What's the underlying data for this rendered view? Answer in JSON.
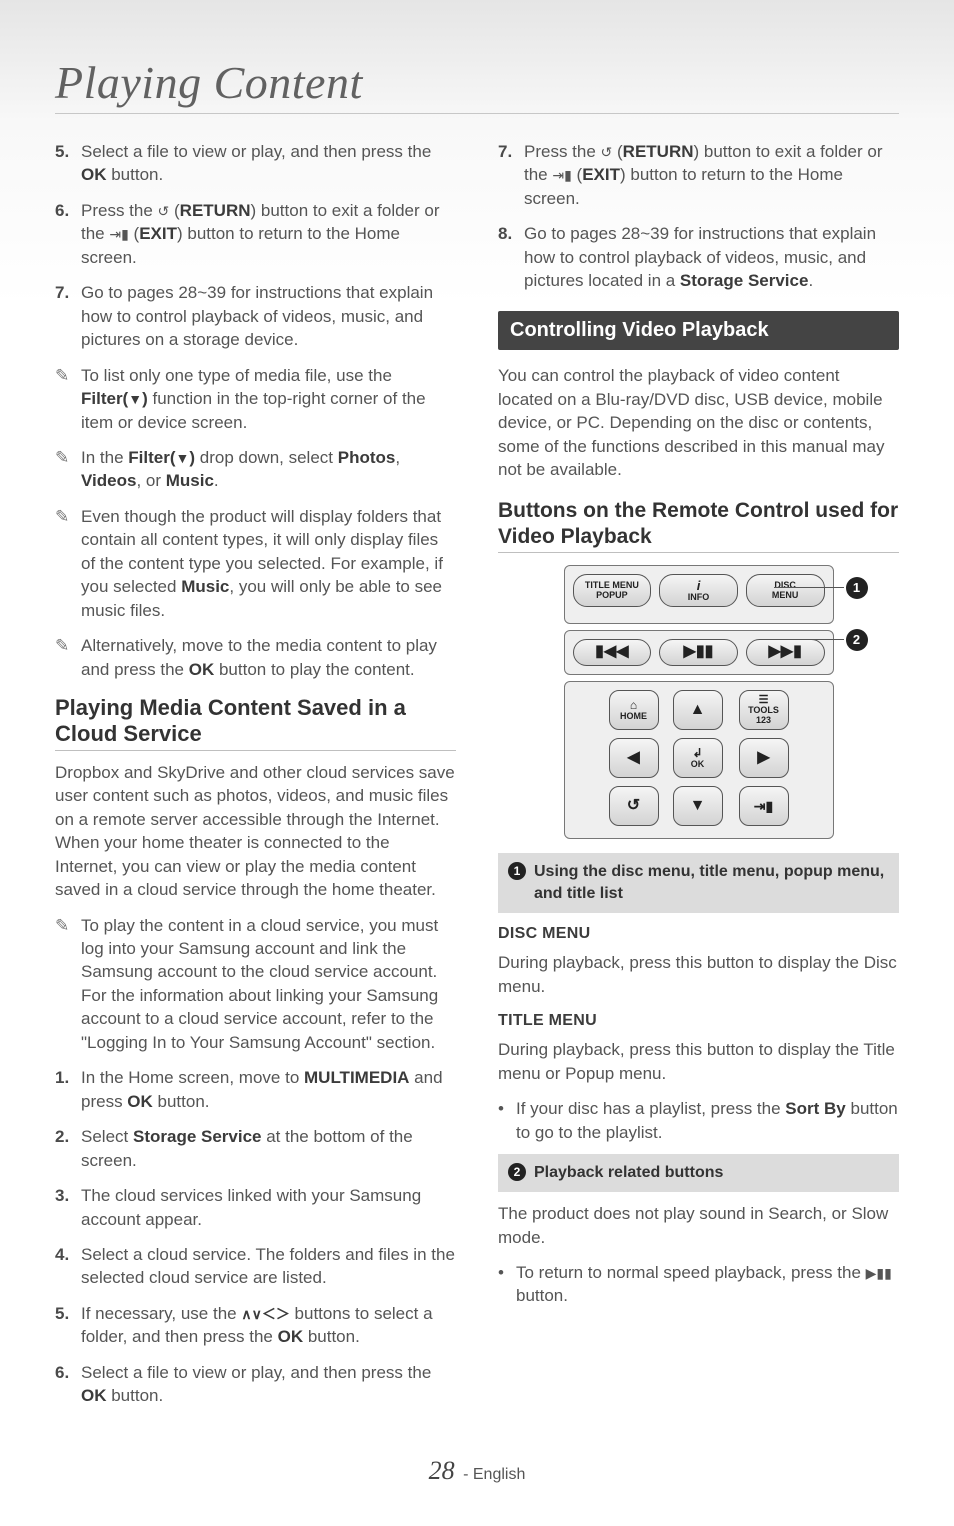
{
  "title": "Playing Content",
  "left": {
    "steps_a": [
      {
        "n": "5.",
        "t1": "Select a file to view or play, and then press the ",
        "b1": "OK",
        "t2": " button."
      },
      {
        "n": "6.",
        "t1": "Press the ",
        "ic1": "↺",
        "t2": " (",
        "b1": "RETURN",
        "t3": ") button to exit a folder or the ",
        "ic2": "⇥▮",
        "t4": " (",
        "b2": "EXIT",
        "t5": ") button to return to the Home screen."
      },
      {
        "n": "7.",
        "t1": "Go to pages 28~39 for instructions that explain how to control playback of videos, music, and pictures on a storage device."
      }
    ],
    "notes_a": [
      {
        "t1": "To list only one type of media file, use the ",
        "b1": "Filter(",
        "ic1": "▼",
        "b2": ")",
        "t2": " function in the top-right corner of the item or device screen."
      },
      {
        "t1": "In the ",
        "b1": "Filter(",
        "ic1": "▼",
        "b2": ")",
        "t2": " drop down, select ",
        "b3": "Photos",
        "t3": ", ",
        "b4": "Videos",
        "t4": ", or ",
        "b5": "Music",
        "t5": "."
      },
      {
        "t1": "Even though the product will display folders that contain all content types, it will only display files of the content type you selected. For example, if you selected ",
        "b1": "Music",
        "t2": ", you will only be  able to see music files."
      },
      {
        "t1": "Alternatively, move to the media content to play and press the ",
        "b1": "OK",
        "t2": " button to play the content."
      }
    ],
    "h2_cloud": "Playing Media Content Saved in a Cloud Service",
    "cloud_para": "Dropbox and SkyDrive and other cloud services save user content such as photos, videos, and music files on a remote server accessible through the Internet. When your home theater is connected to the Internet, you can view or play the media content saved in a cloud service through the home theater.",
    "cloud_note": {
      "t1": "To play the content in a cloud service, you must log into your Samsung account and link the Samsung account to the cloud service account. For the information about linking your Samsung account to a cloud service account, refer to the \"Logging In to Your Samsung Account\" section."
    },
    "cloud_steps": [
      {
        "n": "1.",
        "t1": "In the Home screen, move to ",
        "b1": "MULTIMEDIA",
        "t2": " and press ",
        "b2": "OK",
        "t3": " button."
      },
      {
        "n": "2.",
        "t1": "Select ",
        "b1": "Storage Service",
        "t2": " at the bottom of the screen."
      },
      {
        "n": "3.",
        "t1": "The cloud services linked with your Samsung account appear."
      },
      {
        "n": "4.",
        "t1": "Select a cloud service. The folders and files in the selected cloud service are listed."
      },
      {
        "n": "5.",
        "t1": "If necessary, use the ",
        "ic1": "∧∨＜＞",
        "t2": " buttons to select a folder, and then press the ",
        "b1": "OK",
        "t3": " button."
      },
      {
        "n": "6.",
        "t1": "Select a file to view or play, and then press the ",
        "b1": "OK",
        "t2": " button."
      }
    ]
  },
  "right": {
    "steps_b": [
      {
        "n": "7.",
        "t1": "Press the ",
        "ic1": "↺",
        "t2": " (",
        "b1": "RETURN",
        "t3": ") button to exit a folder or the ",
        "ic2": "⇥▮",
        "t4": " (",
        "b2": "EXIT",
        "t5": ") button to return to the Home screen."
      },
      {
        "n": "8.",
        "t1": "Go to pages 28~39 for instructions that explain how to control playback of videos, music, and pictures located in a ",
        "b1": "Storage Service",
        "t2": "."
      }
    ],
    "section_bar": "Controlling Video Playback",
    "cvp_para": "You can control the playback of video content located on a Blu-ray/DVD disc, USB device, mobile device, or PC. Depending on the disc or contents, some of the functions described in this manual may not be available.",
    "h3_remote": "Buttons on the Remote Control used for Video Playback",
    "remote": {
      "row1": [
        {
          "l1": "TITLE MENU",
          "l2": "POPUP"
        },
        {
          "l1": "i",
          "l2": "INFO"
        },
        {
          "l1": "DISC",
          "l2": "MENU"
        }
      ],
      "row2": [
        "▮◀◀",
        "▶▮▮",
        "▶▶▮"
      ],
      "dpad": {
        "home_label": "HOME",
        "home_icon": "⌂",
        "tools_label": "TOOLS",
        "tools_sub": "123",
        "tools_icon": "☰",
        "ok_label": "OK",
        "ok_icon": "↲",
        "return_icon": "↺",
        "exit_icon": "⇥▮",
        "up": "▲",
        "down": "▼",
        "left": "◀",
        "right": "▶"
      },
      "callout1": "1",
      "callout2": "2"
    },
    "gray1_label": "Using the disc menu, title menu, popup menu, and title list",
    "dm_h": "DISC MENU",
    "dm_p": "During playback, press this button to display the Disc menu.",
    "tm_h": "TITLE MENU",
    "tm_p": "During playback, press this button to display the Title menu or Popup menu.",
    "tm_bul": {
      "t1": "If your disc has a playlist, press the ",
      "b1": "Sort By",
      "t2": " button to go to the playlist."
    },
    "gray2_label": "Playback related buttons",
    "pb_p": "The product does not play sound in Search, or Slow mode.",
    "pb_bul": {
      "t1": "To return to normal speed playback, press the ",
      "ic1": "▶▮▮",
      "t2": " button."
    }
  },
  "footer": {
    "page": "28",
    "lang": "English"
  }
}
